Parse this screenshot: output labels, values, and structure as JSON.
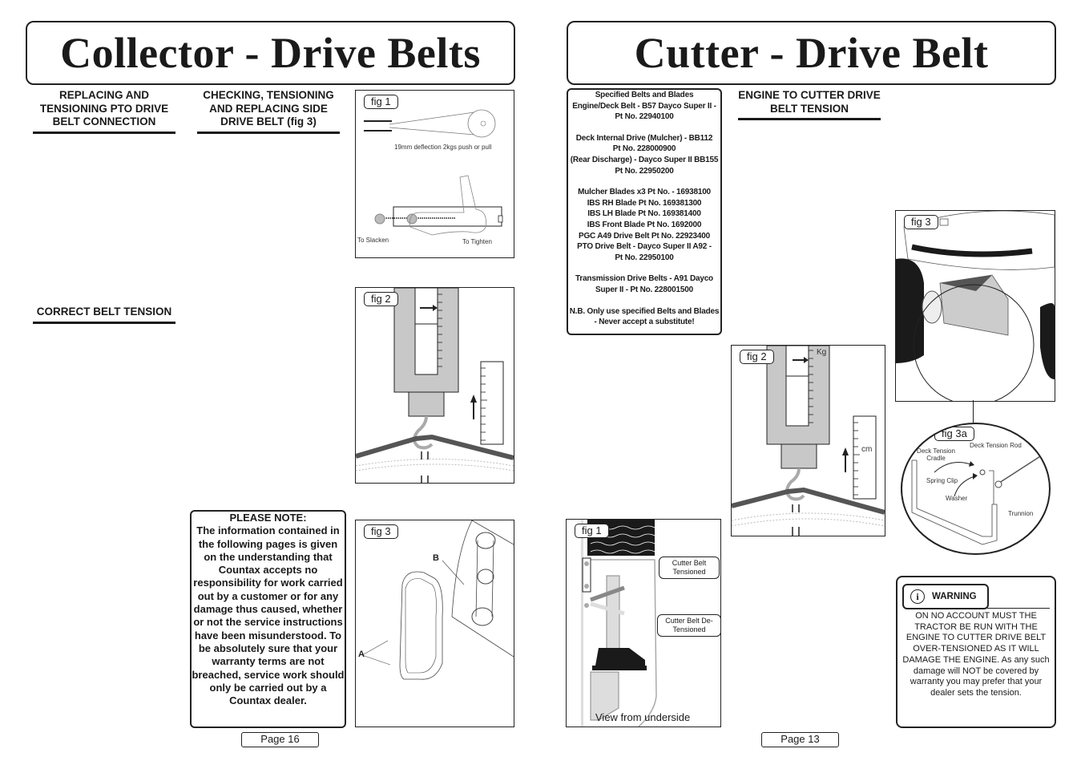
{
  "left_page": {
    "title": "Collector - Drive Belts",
    "headings": {
      "pto": "REPLACING AND TENSIONING PTO DRIVE BELT CONNECTION",
      "side": "CHECKING, TENSIONING AND REPLACING SIDE DRIVE BELT (fig 3)",
      "correct": "CORRECT BELT TENSION"
    },
    "fig1": {
      "label": "fig 1",
      "caption": "19mm deflection 2kgs push or pull",
      "to_slacken": "To Slacken",
      "to_tighten": "To Tighten"
    },
    "fig2": {
      "label": "fig 2"
    },
    "fig3": {
      "label": "fig 3",
      "callout_a": "A",
      "callout_b": "B"
    },
    "note": {
      "title": "PLEASE NOTE:",
      "body": "The information contained in the following pages is given on the understanding that Countax accepts no responsibility for work carried out by a customer or for any damage thus caused, whether or not the service instructions have been misunderstood. To be absolutely sure that your warranty terms are not breached, service work should only be carried out by a Countax dealer."
    },
    "page_number": "Page 16"
  },
  "right_page": {
    "title": "Cutter - Drive Belt",
    "specs": {
      "title": "Specified Belts and Blades",
      "groups": [
        [
          "Engine/Deck Belt - B57 Dayco Super II -",
          "Pt No. 22940100"
        ],
        [
          "Deck Internal Drive (Mulcher) - BB112",
          "Pt No. 228000900",
          "(Rear Discharge) - Dayco Super II BB155",
          "Pt No.  22950200"
        ],
        [
          "Mulcher Blades x3 Pt No. - 16938100",
          "IBS RH Blade Pt No. 169381300",
          "IBS LH Blade Pt No. 169381400",
          "IBS Front Blade Pt No. 1692000",
          "PGC A49 Drive Belt Pt No. 22923400",
          "PTO Drive Belt -  Dayco Super II A92 -",
          "Pt No. 22950100"
        ],
        [
          "Transmission Drive Belts - A91 Dayco",
          "Super II - Pt No. 228001500"
        ],
        [
          "N.B. Only use specified Belts and Blades",
          "- Never accept a substitute!"
        ]
      ]
    },
    "heading": "ENGINE TO CUTTER DRIVE BELT TENSION",
    "fig1": {
      "label": "fig 1",
      "tensioned": "Cutter Belt Tensioned",
      "detensioned": "Cutter Belt De-Tensioned",
      "caption": "View from underside"
    },
    "fig2": {
      "label": "fig 2",
      "unit_kg": "Kg",
      "unit_cm": "cm"
    },
    "fig3": {
      "label": "fig 3"
    },
    "fig3a": {
      "label": "fig 3a",
      "parts": {
        "cradle": "Deck Tension Cradle",
        "rod": "Deck Tension Rod",
        "clip": "Spring Clip",
        "washer": "Washer",
        "trunnion": "Trunnion"
      }
    },
    "warning": {
      "icon": "info-icon",
      "label": "WARNING",
      "text": "ON NO ACCOUNT MUST THE TRACTOR BE RUN WITH THE ENGINE TO CUTTER DRIVE BELT OVER-TENSIONED AS IT WILL DAMAGE THE ENGINE. As any such damage will NOT be covered by warranty you may prefer that your dealer sets the tension."
    },
    "page_number": "Page 13"
  }
}
